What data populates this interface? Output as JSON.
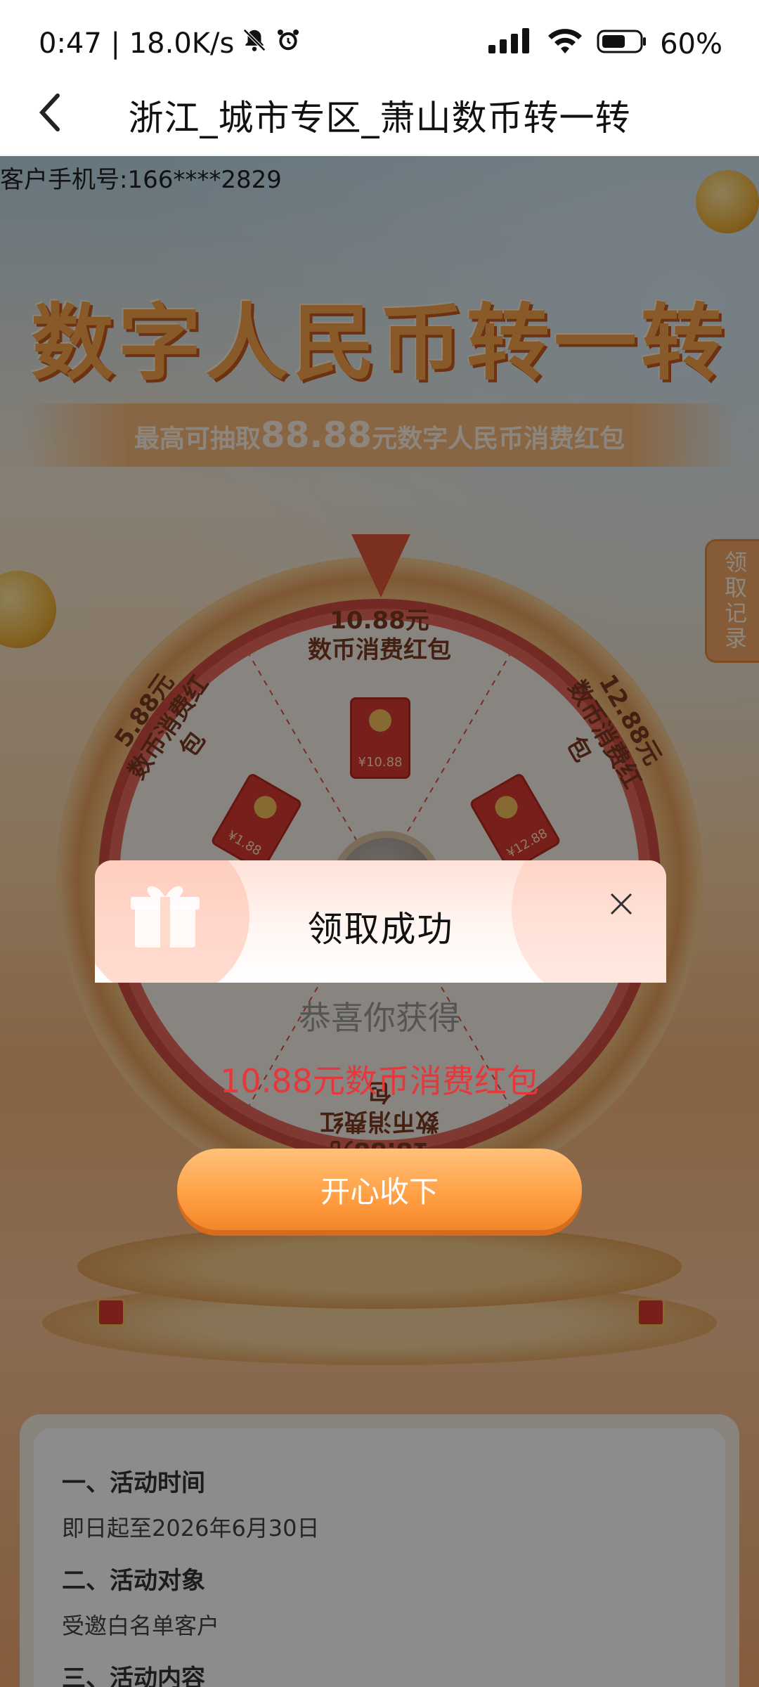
{
  "status_bar": {
    "time_speed": "0:47 | 18.0K/s",
    "battery": "60%",
    "icons": [
      "bell-off-icon",
      "alarm-icon",
      "signal-icon",
      "wifi-icon",
      "battery-icon"
    ]
  },
  "nav": {
    "title": "浙江_城市专区_萧山数币转一转",
    "back_icon": "chevron-left-icon"
  },
  "page": {
    "phone_label": "客户手机号:166****2829",
    "banner_title": "数字人民币转一转",
    "banner_sub_prefix": "最高可抽取",
    "banner_sub_amount": "88.88",
    "banner_sub_suffix": "元数字人民币消费红包",
    "records_tab": "领取记录"
  },
  "wheel": {
    "prizes": [
      {
        "amount": "10.88元",
        "desc": "数币消费红包",
        "envelope": "¥10.88"
      },
      {
        "amount": "12.88元",
        "desc": "数币消费红包",
        "envelope": "¥12.88"
      },
      {
        "amount": "5.88元",
        "desc": "数币消费红包",
        "envelope": "¥1.88"
      },
      {
        "amount": "18.88元",
        "desc": "数币消费红包",
        "envelope": ""
      }
    ]
  },
  "dialog": {
    "title": "领取成功",
    "congrats": "恭喜你获得",
    "prize": "10.88元数币消费红包",
    "accept_button": "开心收下",
    "close_icon": "close-icon",
    "gift_icon": "gift-icon"
  },
  "rules": {
    "items": [
      {
        "heading": "一、活动时间",
        "text": "即日起至2026年6月30日"
      },
      {
        "heading": "二、活动对象",
        "text": "受邀白名单客户"
      },
      {
        "heading": "三、活动内容",
        "text": ""
      }
    ]
  },
  "colors": {
    "accent_orange": "#ff9f42",
    "prize_red": "#e5383b",
    "wheel_red": "#e7685c"
  }
}
